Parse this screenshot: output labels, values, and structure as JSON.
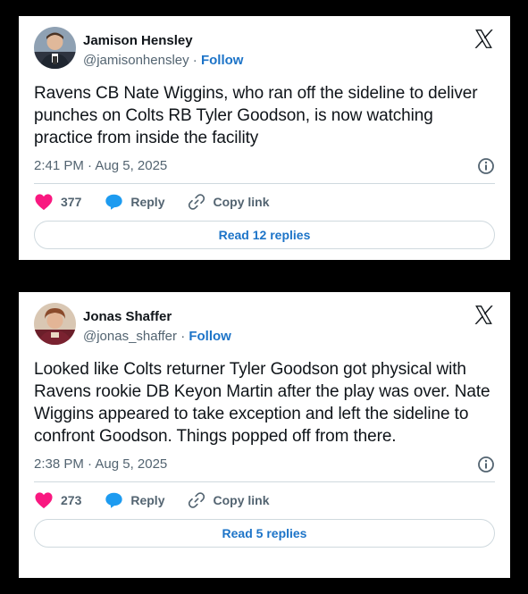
{
  "tweets": [
    {
      "author_name": "Jamison Hensley",
      "handle": "@jamisonhensley",
      "follow_label": "Follow",
      "separator": "·",
      "text": "Ravens CB Nate Wiggins, who ran off the sideline to deliver punches on Colts RB Tyler Goodson, is now watching practice from inside the facility",
      "timestamp": "2:41 PM · Aug 5, 2025",
      "like_count": "377",
      "reply_label": "Reply",
      "copy_link_label": "Copy link",
      "read_replies_label": "Read 12 replies"
    },
    {
      "author_name": "Jonas Shaffer",
      "handle": "@jonas_shaffer",
      "follow_label": "Follow",
      "separator": "·",
      "text": "Looked like Colts returner Tyler Goodson got physical with Ravens rookie DB Keyon Martin after the play was over. Nate Wiggins appeared to take exception and left the sideline to confront Goodson. Things popped off from there.",
      "timestamp": "2:38 PM · Aug 5, 2025",
      "like_count": "273",
      "reply_label": "Reply",
      "copy_link_label": "Copy link",
      "read_replies_label": "Read 5 replies"
    }
  ],
  "colors": {
    "like": "#f91880",
    "reply": "#1d9bf0",
    "link": "#1d74c8"
  },
  "icons": [
    "x-logo-icon",
    "info-icon",
    "heart-icon",
    "reply-bubble-icon",
    "link-icon"
  ]
}
